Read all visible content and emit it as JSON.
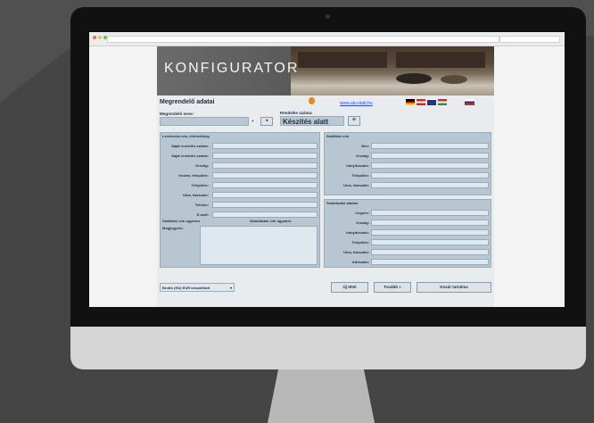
{
  "header": {
    "banner_title": "KONFIGURATOR",
    "section_title": "Megrendelő adatai",
    "website_link": "www.alu-stab.hu"
  },
  "top_fields": {
    "orderer_label": "Megrendelő neve:",
    "order_number_label": "Rendelés száma:",
    "status_value": "Készítés alatt",
    "plus_label": "+"
  },
  "delivery": {
    "title": "Levelezési cím, elérhetőség",
    "labels": [
      "Saját rendelés száma:",
      "Saját rendelés száma:",
      "Ország:",
      "Irszám, település:",
      "Település:",
      "Utca, házszám:",
      "Telefon:",
      "E-mail:"
    ],
    "checkbox1": "Szállítási cím ugyanez",
    "checkbox2": "Számlázási cím ugyanez",
    "notes_label": "Megjegyzés:"
  },
  "shipping": {
    "title": "Szállítási cím",
    "labels": [
      "Név:",
      "Ország:",
      "Irányítószám:",
      "Település:",
      "Utca, házszám:"
    ]
  },
  "billing": {
    "title": "Számlázási adatok",
    "labels": [
      "Cégnév:",
      "Ország:",
      "Irányítószám:",
      "Település:",
      "Utca, házszám:",
      "Adószám:"
    ]
  },
  "footer": {
    "currency_select": "Bruttó (HU) EUR beszállított",
    "new_button": "Új tétel",
    "next_button": "Tovább »",
    "cart_button": "Kosár tartalma"
  },
  "colors": {
    "accent": "#b7c6d0",
    "link": "#2a4ad0"
  }
}
